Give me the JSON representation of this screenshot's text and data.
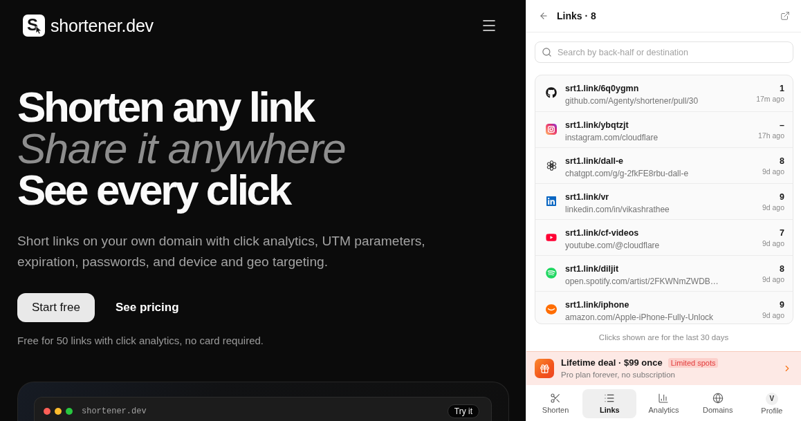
{
  "header": {
    "logo": {
      "mark": "S",
      "name": "shortener.dev"
    }
  },
  "hero": {
    "headline": [
      {
        "text": "Shorten any link",
        "kind": "plain"
      },
      {
        "text": "Share it anywhere",
        "kind": "emphasis"
      },
      {
        "text": "See every click",
        "kind": "plain"
      }
    ],
    "description": "Short links on your own domain with click analytics, UTM parameters, expiration, passwords, and device and geo targeting.",
    "buttons": [
      {
        "label": "Start free",
        "kind": "primary"
      },
      {
        "label": "See pricing",
        "kind": "ghost"
      }
    ],
    "note": "Free for 50 links with click analytics, no card required."
  },
  "preview": {
    "window_title": "shortener.dev",
    "action": "Try it"
  },
  "panel": {
    "title": "Links · 8",
    "search": {
      "placeholder": "Search by back-half or destination"
    },
    "links": [
      {
        "short": "srt1.link/6q0ygmn",
        "destination": "github.com/Agenty/shortener/pull/30",
        "clicks": "1",
        "time": "17m ago"
      },
      {
        "short": "srt1.link/ybqtzjt",
        "destination": "instagram.com/cloudflare",
        "clicks": "–",
        "time": "17h ago"
      },
      {
        "short": "srt1.link/dall-e",
        "destination": "chatgpt.com/g/g-2fkFE8rbu-dall-e",
        "clicks": "8",
        "time": "9d ago"
      },
      {
        "short": "srt1.link/vr",
        "destination": "linkedin.com/in/vikashrathee",
        "clicks": "9",
        "time": "9d ago"
      },
      {
        "short": "srt1.link/cf-videos",
        "destination": "youtube.com/@cloudflare",
        "clicks": "7",
        "time": "9d ago"
      },
      {
        "short": "srt1.link/diljit",
        "destination": "open.spotify.com/artist/2FKWNmZWDB…",
        "clicks": "8",
        "time": "9d ago"
      },
      {
        "short": "srt1.link/iphone",
        "destination": "amazon.com/Apple-iPhone-Fully-Unlock",
        "clicks": "9",
        "time": "9d ago"
      }
    ],
    "footnote": "Clicks shown are for the last 30 days",
    "promo": {
      "title": "Lifetime deal · $99 once",
      "badge": "Limited spots",
      "subtitle": "Pro plan forever, no subscription"
    },
    "nav": [
      {
        "label": "Shorten",
        "selected": false
      },
      {
        "label": "Links",
        "selected": true
      },
      {
        "label": "Analytics",
        "selected": false
      },
      {
        "label": "Domains",
        "selected": false
      },
      {
        "label": "Profile",
        "selected": false,
        "avatar": "V"
      }
    ]
  }
}
